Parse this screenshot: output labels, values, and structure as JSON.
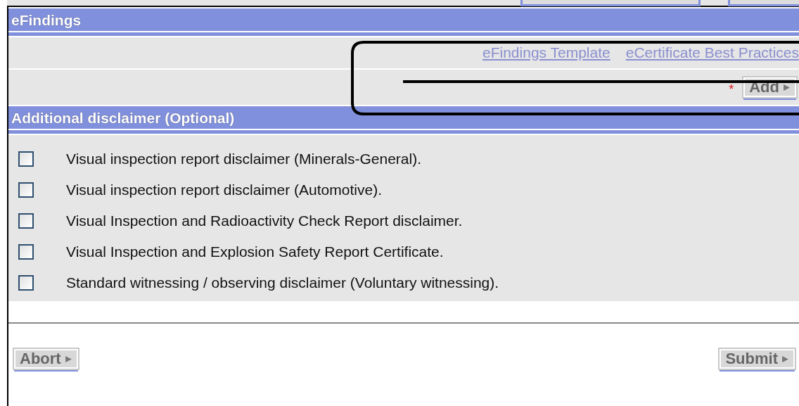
{
  "sections": [
    {
      "kind": "efindings",
      "title": "eFindings",
      "links": [
        "eFindings Template",
        "eCertificate Best Practices"
      ],
      "required_mark": "*",
      "add_button": "Add"
    },
    {
      "kind": "disclaimers",
      "title": "Additional disclaimer (Optional)",
      "options": [
        {
          "label": "Visual inspection report disclaimer (Minerals-General).",
          "checked": false
        },
        {
          "label": "Visual inspection report disclaimer (Automotive).",
          "checked": false
        },
        {
          "label": "Visual Inspection and Radioactivity Check Report disclaimer.",
          "checked": false
        },
        {
          "label": "Visual Inspection and Explosion Safety Report Certificate.",
          "checked": false
        },
        {
          "label": "Standard witnessing / observing disclaimer (Voluntary witnessing).",
          "checked": false
        }
      ]
    }
  ],
  "buttons": {
    "abort": "Abort",
    "submit": "Submit"
  }
}
